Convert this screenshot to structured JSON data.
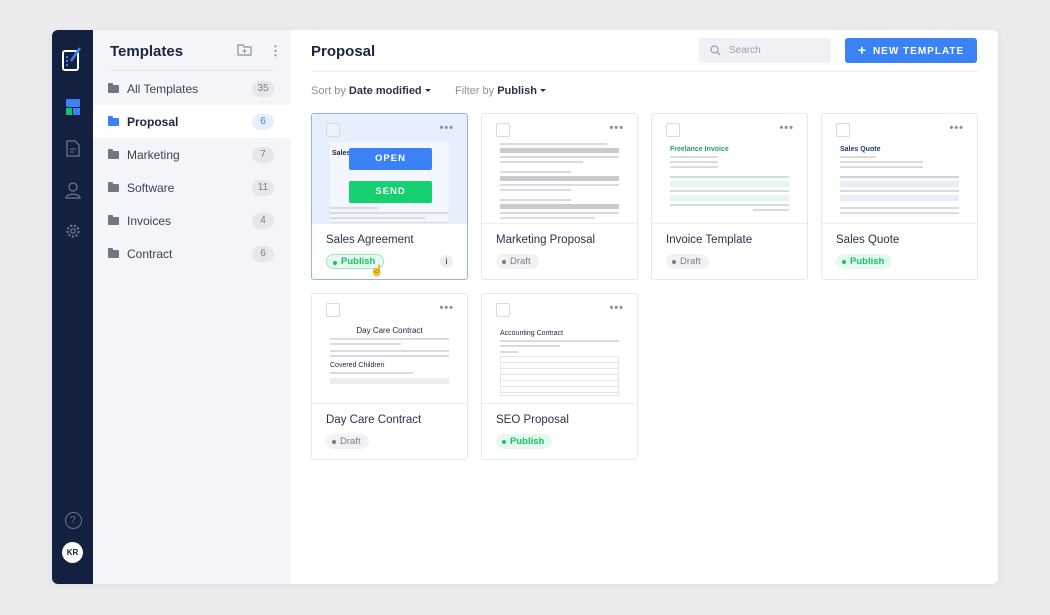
{
  "sidebar": {
    "title": "Templates",
    "items": [
      {
        "label": "All Templates",
        "count": "35"
      },
      {
        "label": "Proposal",
        "count": "6"
      },
      {
        "label": "Marketing",
        "count": "7"
      },
      {
        "label": "Software",
        "count": "11"
      },
      {
        "label": "Invoices",
        "count": "4"
      },
      {
        "label": "Contract",
        "count": "6"
      }
    ]
  },
  "rail": {
    "avatar": "KR",
    "help": "?"
  },
  "header": {
    "title": "Proposal",
    "search_placeholder": "Search",
    "new_button": "NEW TEMPLATE"
  },
  "filters": {
    "sort_label": "Sort by",
    "sort_value": "Date modified",
    "filter_label": "Filter by",
    "filter_value": "Publish"
  },
  "overlay": {
    "open": "OPEN",
    "send": "SEND"
  },
  "cards": [
    {
      "name": "Sales Agreement",
      "status": "Publish",
      "doc_title": "Sales A"
    },
    {
      "name": "Marketing Proposal",
      "status": "Draft",
      "doc_title": ""
    },
    {
      "name": "Invoice Template",
      "status": "Draft",
      "doc_title": "Freelance Invoice"
    },
    {
      "name": "Sales Quote",
      "status": "Publish",
      "doc_title": "Sales Quote"
    },
    {
      "name": "Day Care Contract",
      "status": "Draft",
      "doc_title": "Day Care Contract",
      "doc_sub": "Covered Children"
    },
    {
      "name": "SEO Proposal",
      "status": "Publish",
      "doc_title": "Accounting Contract"
    }
  ],
  "colors": {
    "accent": "#3b82f6",
    "publish": "#15c26b",
    "rail": "#13203f"
  }
}
